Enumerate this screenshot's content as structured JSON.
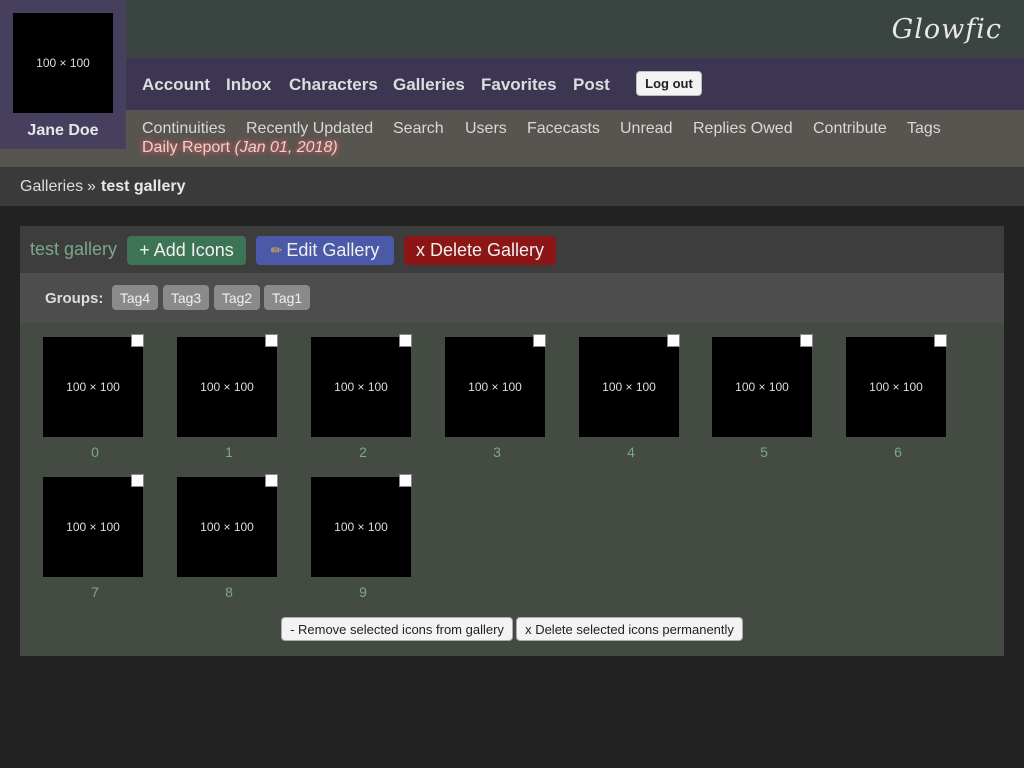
{
  "site": {
    "logo": "Glowfic"
  },
  "user": {
    "avatar_text": "100 × 100",
    "name": "Jane Doe"
  },
  "nav": {
    "items": [
      "Account",
      "Inbox",
      "Characters",
      "Galleries",
      "Favorites",
      "Post"
    ],
    "logout": "Log out"
  },
  "subnav": {
    "items": [
      "Continuities",
      "Recently Updated",
      "Search",
      "Users",
      "Facecasts",
      "Unread",
      "Replies Owed",
      "Contribute",
      "Tags"
    ],
    "daily_report": "Daily Report",
    "daily_report_date": "(Jan 01, 2018)"
  },
  "breadcrumb": {
    "parent": "Galleries",
    "separator": "»",
    "current": "test gallery"
  },
  "gallery": {
    "title": "test gallery",
    "add_icons": "+ Add Icons",
    "edit_gallery": "Edit Gallery",
    "delete_gallery": "x Delete Gallery",
    "groups_label": "Groups:",
    "tags": [
      "Tag4",
      "Tag3",
      "Tag2",
      "Tag1"
    ],
    "icons": [
      {
        "placeholder": "100 × 100",
        "label": "0"
      },
      {
        "placeholder": "100 × 100",
        "label": "1"
      },
      {
        "placeholder": "100 × 100",
        "label": "2"
      },
      {
        "placeholder": "100 × 100",
        "label": "3"
      },
      {
        "placeholder": "100 × 100",
        "label": "4"
      },
      {
        "placeholder": "100 × 100",
        "label": "5"
      },
      {
        "placeholder": "100 × 100",
        "label": "6"
      },
      {
        "placeholder": "100 × 100",
        "label": "7"
      },
      {
        "placeholder": "100 × 100",
        "label": "8"
      },
      {
        "placeholder": "100 × 100",
        "label": "9"
      }
    ],
    "remove_selected": "- Remove selected icons from gallery",
    "delete_selected": "x Delete selected icons permanently"
  },
  "colors": {
    "header": "#3a4440",
    "nav": "#3c3652",
    "user_box": "#463f5e",
    "add": "#3d7456",
    "edit": "#4a5aa8",
    "delete": "#8c1515",
    "accent_text": "#7aa889"
  },
  "icons_used": [
    "pencil-icon"
  ]
}
